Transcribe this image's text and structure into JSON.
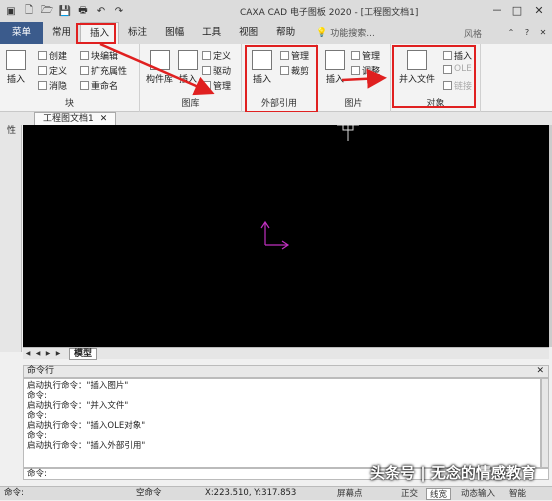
{
  "title_bar": {
    "app_title": "CAXA CAD 电子图板 2020 - [工程图文档1]",
    "quick_access": [
      "new-file-icon",
      "open-folder-icon",
      "save-icon",
      "print-icon",
      "undo-icon",
      "redo-icon"
    ],
    "window_buttons": [
      "－",
      "□",
      "✕"
    ]
  },
  "ribbon": {
    "tabs": [
      {
        "label": "菜单",
        "id": "menu"
      },
      {
        "label": "常用",
        "id": "common"
      },
      {
        "label": "插入",
        "id": "insert"
      },
      {
        "label": "标注",
        "id": "dimension"
      },
      {
        "label": "图幅",
        "id": "sheet"
      },
      {
        "label": "工具",
        "id": "tools"
      },
      {
        "label": "视图",
        "id": "view"
      },
      {
        "label": "帮助",
        "id": "help"
      }
    ],
    "search_placeholder": "功能搜索...",
    "style_label": "风格",
    "groups": {
      "block": {
        "label": "块",
        "insert_label": "插入",
        "items": [
          "创建",
          "定义",
          "消隐",
          "块编辑",
          "扩充属性",
          "重命名"
        ]
      },
      "library": {
        "label": "图库",
        "component_label": "构件库",
        "insert_label": "插入",
        "items": [
          "定义",
          "驱动",
          "管理"
        ]
      },
      "xref": {
        "label": "外部引用",
        "insert_label": "插入",
        "items": [
          "管理",
          "裁剪"
        ]
      },
      "image": {
        "label": "图片",
        "insert_label": "插入",
        "items": [
          "管理",
          "调整"
        ]
      },
      "object": {
        "label": "对象",
        "merge_label": "并入文件",
        "items": [
          "插入",
          "OLE",
          "链接"
        ]
      }
    }
  },
  "document": {
    "tab_label": "工程图文档1",
    "side_label": "特性",
    "model_tab": "模型"
  },
  "command": {
    "header": "命令行",
    "history": [
      "启动执行命令：\"插入图片\"",
      "命令:",
      "启动执行命令：\"并入文件\"",
      "命令:",
      "启动执行命令：\"插入OLE对象\"",
      "命令:",
      "启动执行命令：\"插入外部引用\""
    ],
    "prompt": "命令:"
  },
  "status_bar": {
    "left": "命令:",
    "middle": "空命令",
    "coords": "X:223.510, Y:317.853",
    "buttons": [
      "屏幕点",
      "正交",
      "线宽",
      "动态输入",
      "智能"
    ]
  },
  "watermark": "头条号 | 无念的情感教育",
  "colors": {
    "highlight": "#e02020",
    "ucs": "#c030c0",
    "canvas": "#000000"
  }
}
